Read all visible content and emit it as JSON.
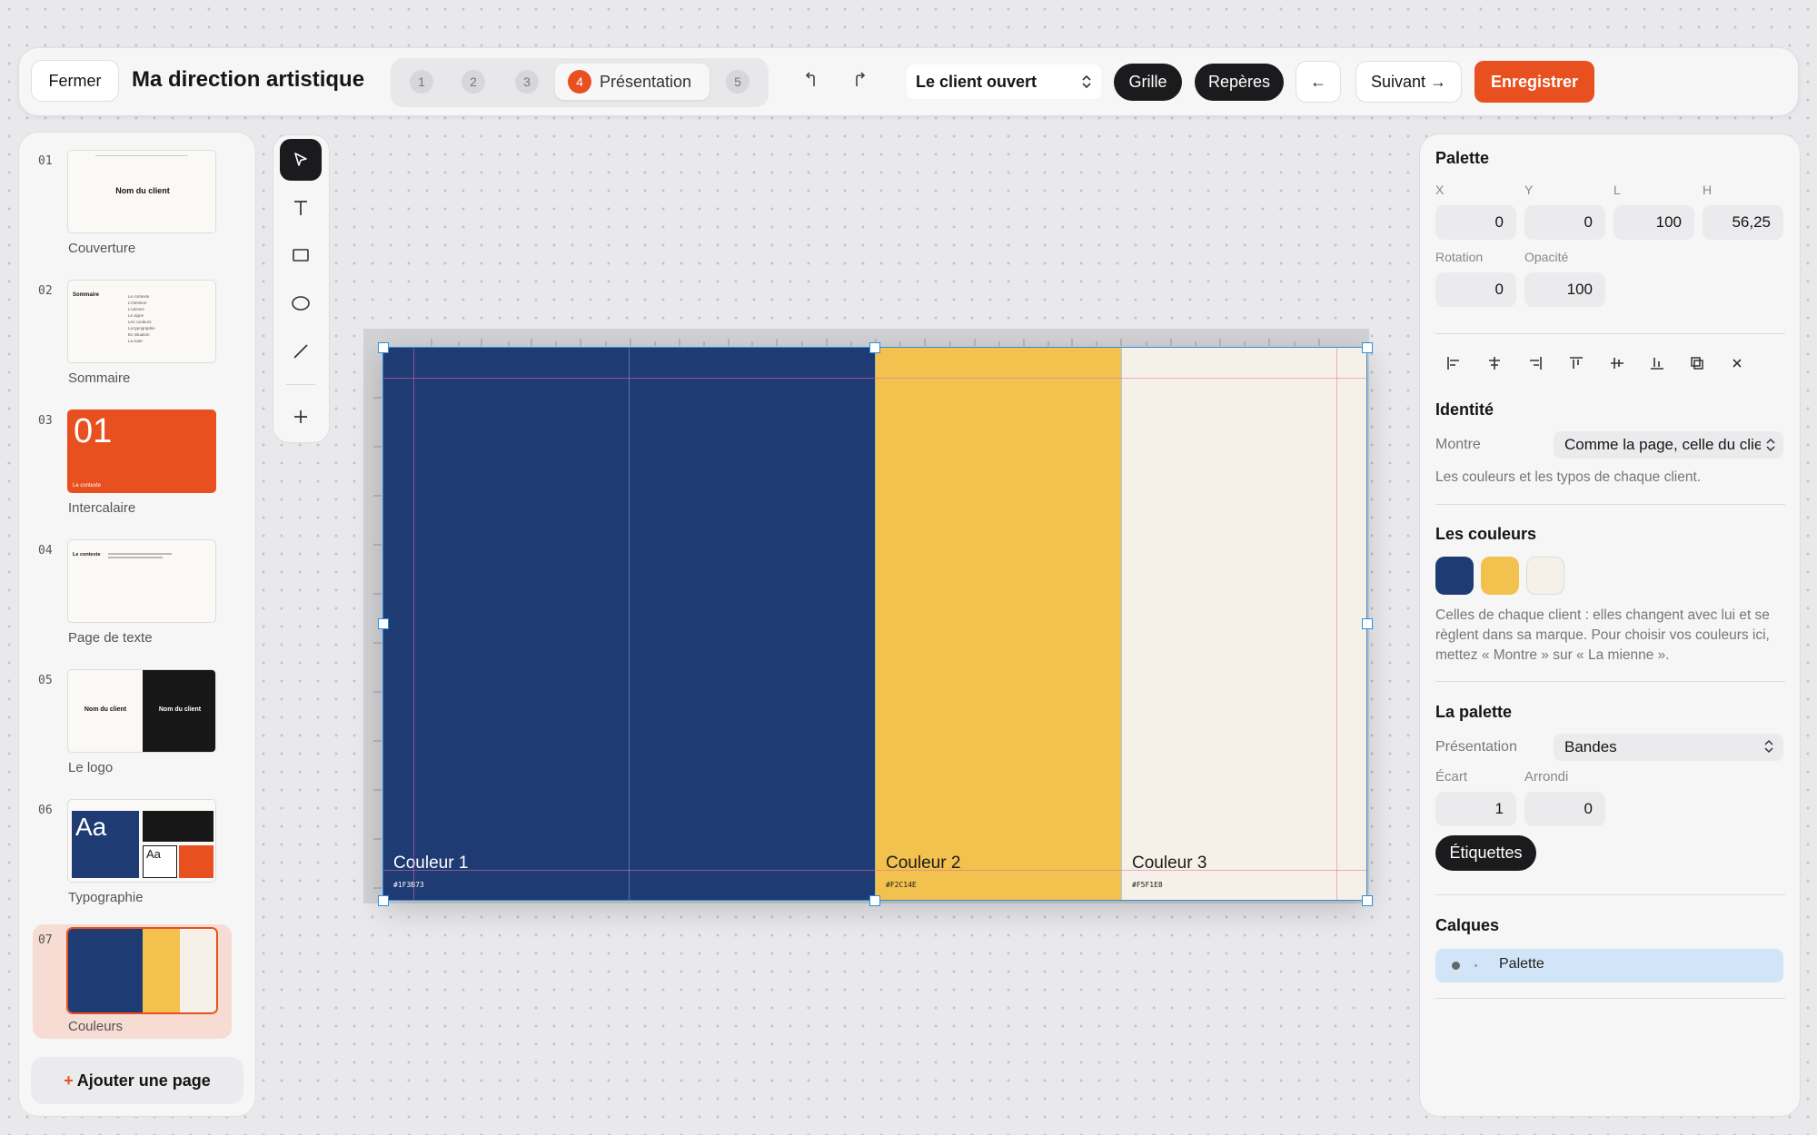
{
  "topbar": {
    "close_label": "Fermer",
    "title": "Ma direction artistique",
    "steps": [
      "1",
      "2",
      "3",
      "4",
      "5"
    ],
    "active_step_label": "Présentation",
    "client_select": "Le client ouvert",
    "grid_label": "Grille",
    "guides_label": "Repères",
    "back_label": "←",
    "next_label": "Suivant →",
    "save_label": "Enregistrer"
  },
  "pages": {
    "items": [
      {
        "num": "01",
        "label": "Couverture",
        "thumb_text": "Nom du client"
      },
      {
        "num": "02",
        "label": "Sommaire",
        "thumb_text": "Sommaire",
        "entries": [
          "Le contexte",
          "L'intention",
          "L'univers",
          "Le signe",
          "Les couleurs",
          "La typographie",
          "En situation",
          "La suite"
        ]
      },
      {
        "num": "03",
        "label": "Intercalaire",
        "thumb_text": "01",
        "thumb_sub": "Le contexte"
      },
      {
        "num": "04",
        "label": "Page de texte",
        "thumb_text": "Le contexte"
      },
      {
        "num": "05",
        "label": "Le logo",
        "thumb_text": "Nom du client"
      },
      {
        "num": "06",
        "label": "Typographie",
        "thumb_text": "Aa"
      },
      {
        "num": "07",
        "label": "Couleurs"
      }
    ],
    "add_label": "Ajouter une page"
  },
  "tools": [
    "select-tool",
    "text-tool",
    "rectangle-tool",
    "ellipse-tool",
    "line-tool",
    "add-tool"
  ],
  "slide": {
    "bands": [
      {
        "name": "Couleur 1",
        "hex": "#1F3B73",
        "color": "#1f3b73",
        "text_color": "#ffffff"
      },
      {
        "name": "Couleur 2",
        "hex": "#F2C14E",
        "color": "#f2c14e",
        "text_color": "#1a1a1a"
      },
      {
        "name": "Couleur 3",
        "hex": "#F5F1E8",
        "color": "#f5f1e8",
        "text_color": "#1a1a1a"
      }
    ]
  },
  "props": {
    "section_title": "Palette",
    "labels": {
      "x": "X",
      "y": "Y",
      "w": "L",
      "h": "H",
      "rotation": "Rotation",
      "opacity": "Opacité"
    },
    "values": {
      "x": "0",
      "y": "0",
      "w": "100",
      "h": "56,25",
      "rotation": "0",
      "opacity": "100"
    },
    "identity": {
      "title": "Identité",
      "show_label": "Montre",
      "show_value": "Comme la page, celle du client",
      "desc": "Les couleurs et les typos de chaque client."
    },
    "colors": {
      "title": "Les couleurs",
      "swatches": [
        "#1f3b73",
        "#f2c14e",
        "#f5f1e8"
      ],
      "desc": "Celles de chaque client : elles changent avec lui et se règlent dans sa marque. Pour choisir vos couleurs ici, mettez « Montre » sur « La mienne »."
    },
    "palette": {
      "title": "La palette",
      "presentation_label": "Présentation",
      "presentation_value": "Bandes",
      "gap_label": "Écart",
      "gap_value": "1",
      "radius_label": "Arrondi",
      "radius_value": "0",
      "labels_toggle": "Étiquettes"
    },
    "layers": {
      "title": "Calques",
      "items": [
        {
          "name": "Palette"
        }
      ]
    }
  }
}
